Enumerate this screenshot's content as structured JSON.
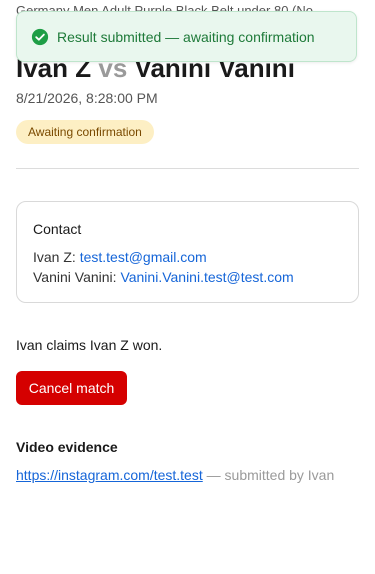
{
  "event": {
    "category_text": "Germany Men Adult Purple Black Belt under 80 (No"
  },
  "toast": {
    "icon": "check-circle-icon",
    "message": "Result submitted — awaiting confirmation",
    "color": "#1e7a39"
  },
  "match": {
    "player1": "Ivan Z",
    "vs": "vs",
    "player2": "Vanini Vanini",
    "datetime": "8/21/2026, 8:28:00 PM",
    "status_badge": "Awaiting confirmation"
  },
  "contact": {
    "title": "Contact",
    "rows": [
      {
        "name": "Ivan Z:",
        "email": "test.test@gmail.com"
      },
      {
        "name": "Vanini Vanini:",
        "email": "Vanini.Vanini.test@test.com"
      }
    ]
  },
  "claim": {
    "text": "Ivan claims Ivan Z won."
  },
  "actions": {
    "cancel_label": "Cancel match",
    "cancel_color": "#d50000"
  },
  "video": {
    "title": "Video evidence",
    "link": "https://instagram.com/test.test",
    "submitted_by": "— submitted by Ivan"
  }
}
